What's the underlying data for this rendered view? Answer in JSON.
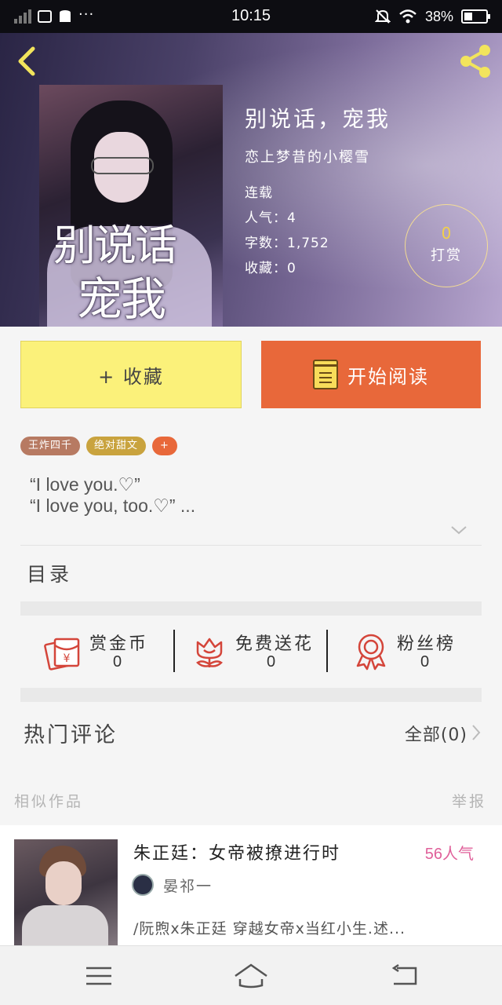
{
  "status_bar": {
    "time": "10:15",
    "battery": "38%",
    "battery_level": 0.38,
    "icons": [
      "signal-icon",
      "mail-icon",
      "sim-icon",
      "more-dots-icon",
      "mute-icon",
      "wifi-icon",
      "battery-icon"
    ]
  },
  "header": {
    "back_icon": "back-chevron-icon",
    "share_icon": "share-icon",
    "cover_title_line1": "别说话",
    "cover_title_line2": "宠我"
  },
  "book": {
    "title": "别说话，宠我",
    "author": "恋上梦昔的小樱雪",
    "status": "连载",
    "popularity": "人气：4",
    "word_count": "字数：1,752",
    "favorites": "收藏：0",
    "reward_count": "0",
    "reward_label": "打赏"
  },
  "actions": {
    "collect_label": "+ 收藏",
    "read_label": "开始阅读",
    "read_icon": "book-icon"
  },
  "tags": [
    {
      "label": "王炸四千",
      "color": "#b77a62"
    },
    {
      "label": "绝对甜文",
      "color": "#c9a33e"
    },
    {
      "label": "+",
      "color": "#e8683a"
    }
  ],
  "description": {
    "line1": "“I love you.♡”",
    "line2": "“I love you, too.♡” ...",
    "expand_icon": "chevron-down-icon"
  },
  "toc_label": "目录",
  "stats": [
    {
      "label": "赏金币",
      "value": "0",
      "icon": "red-envelope-icon"
    },
    {
      "label": "免费送花",
      "value": "0",
      "icon": "flower-icon"
    },
    {
      "label": "粉丝榜",
      "value": "0",
      "icon": "medal-icon"
    }
  ],
  "comments": {
    "title": "热门评论",
    "all_label": "全部(0)"
  },
  "similar": {
    "label": "相似作品",
    "report_label": "举报",
    "item": {
      "title": "朱正廷：女帝被撩进行时",
      "popularity": "56人气",
      "author": "晏祁一",
      "description": "/阮煦x朱正廷 穿越女帝x当红小生.述..."
    }
  },
  "nav_bar": {
    "icons": [
      "menu-icon",
      "home-icon",
      "back-icon"
    ]
  },
  "colors": {
    "accent_orange": "#e8683a",
    "collect_yellow": "#fbf17a",
    "reward_gold": "#f2d04a",
    "popularity_pink": "#e0609a",
    "stat_icon_red": "#d4453a"
  }
}
